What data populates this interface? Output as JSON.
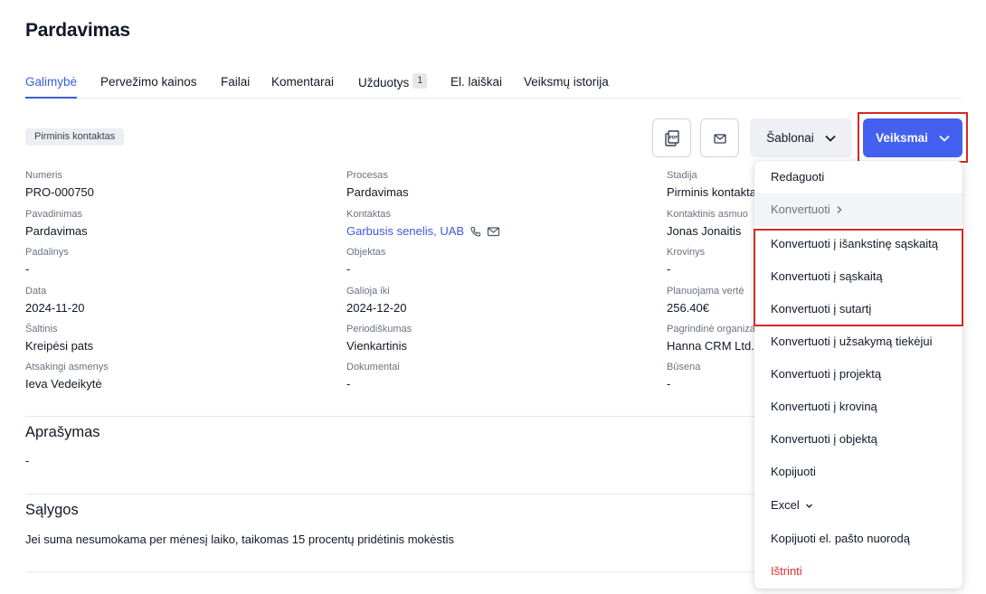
{
  "page": {
    "title": "Pardavimas"
  },
  "tabs": [
    {
      "label": "Galimybė"
    },
    {
      "label": "Pervežimo kainos"
    },
    {
      "label": "Failai"
    },
    {
      "label": "Komentarai"
    },
    {
      "label": "Užduotys",
      "badge": "1"
    },
    {
      "label": "El. laiškai"
    },
    {
      "label": "Veiksmų istorija"
    }
  ],
  "stage_badge": "Pirminis kontaktas",
  "toolbar": {
    "pdf_icon": "pdf-document-icon",
    "email_icon": "envelope-icon",
    "templates_label": "Šablonai",
    "actions_label": "Veiksmai"
  },
  "fields": {
    "col1": [
      {
        "label": "Numeris",
        "value": "PRO-000750"
      },
      {
        "label": "Pavadinimas",
        "value": "Pardavimas"
      },
      {
        "label": "Padalinys",
        "value": "-"
      },
      {
        "label": "Data",
        "value": "2024-11-20"
      },
      {
        "label": "Šaltinis",
        "value": "Kreipėsi pats"
      },
      {
        "label": "Atsakingi asmenys",
        "value": "Ieva Vedeikytė"
      }
    ],
    "col2": [
      {
        "label": "Procesas",
        "value": "Pardavimas"
      },
      {
        "label": "Kontaktas",
        "value": "Garbusis senelis, UAB"
      },
      {
        "label": "Objektas",
        "value": "-"
      },
      {
        "label": "Galioja iki",
        "value": "2024-12-20"
      },
      {
        "label": "Periodiškumas",
        "value": "Vienkartinis"
      },
      {
        "label": "Dokumentai",
        "value": "-"
      }
    ],
    "col3": [
      {
        "label": "Stadija",
        "value": "Pirminis kontaktas"
      },
      {
        "label": "Kontaktinis asmuo",
        "value": "Jonas Jonaitis"
      },
      {
        "label": "Krovinys",
        "value": "-"
      },
      {
        "label": "Planuojama vertė",
        "value": "256.40€"
      },
      {
        "label": "Pagrindinė organizacija",
        "value": "Hanna CRM Ltd."
      },
      {
        "label": "Būsena",
        "value": "-"
      }
    ]
  },
  "description": {
    "title": "Aprašymas",
    "text": "-"
  },
  "conditions": {
    "title": "Sąlygos",
    "text": "Jei suma nesumokama per mėnesį laiko, taikomas 15 procentų pridėtinis mokėstis"
  },
  "menu": {
    "edit": "Redaguoti",
    "convert": "Konvertuoti",
    "convert_prepayment_invoice": "Konvertuoti į išankstinę sąskaitą",
    "convert_invoice": "Konvertuoti į sąskaitą",
    "convert_contract": "Konvertuoti į sutartį",
    "convert_supplier_order": "Konvertuoti į užsakymą tiekėjui",
    "convert_project": "Konvertuoti į projektą",
    "convert_cargo": "Konvertuoti į kroviną",
    "convert_object": "Konvertuoti į objektą",
    "copy": "Kopijuoti",
    "excel": "Excel",
    "copy_email_link": "Kopijuoti el. pašto nuorodą",
    "delete": "Ištrinti"
  },
  "colors": {
    "accent": "#4361ee",
    "link": "#3b5bdb",
    "danger": "#e03131",
    "highlight": "#d62828"
  }
}
